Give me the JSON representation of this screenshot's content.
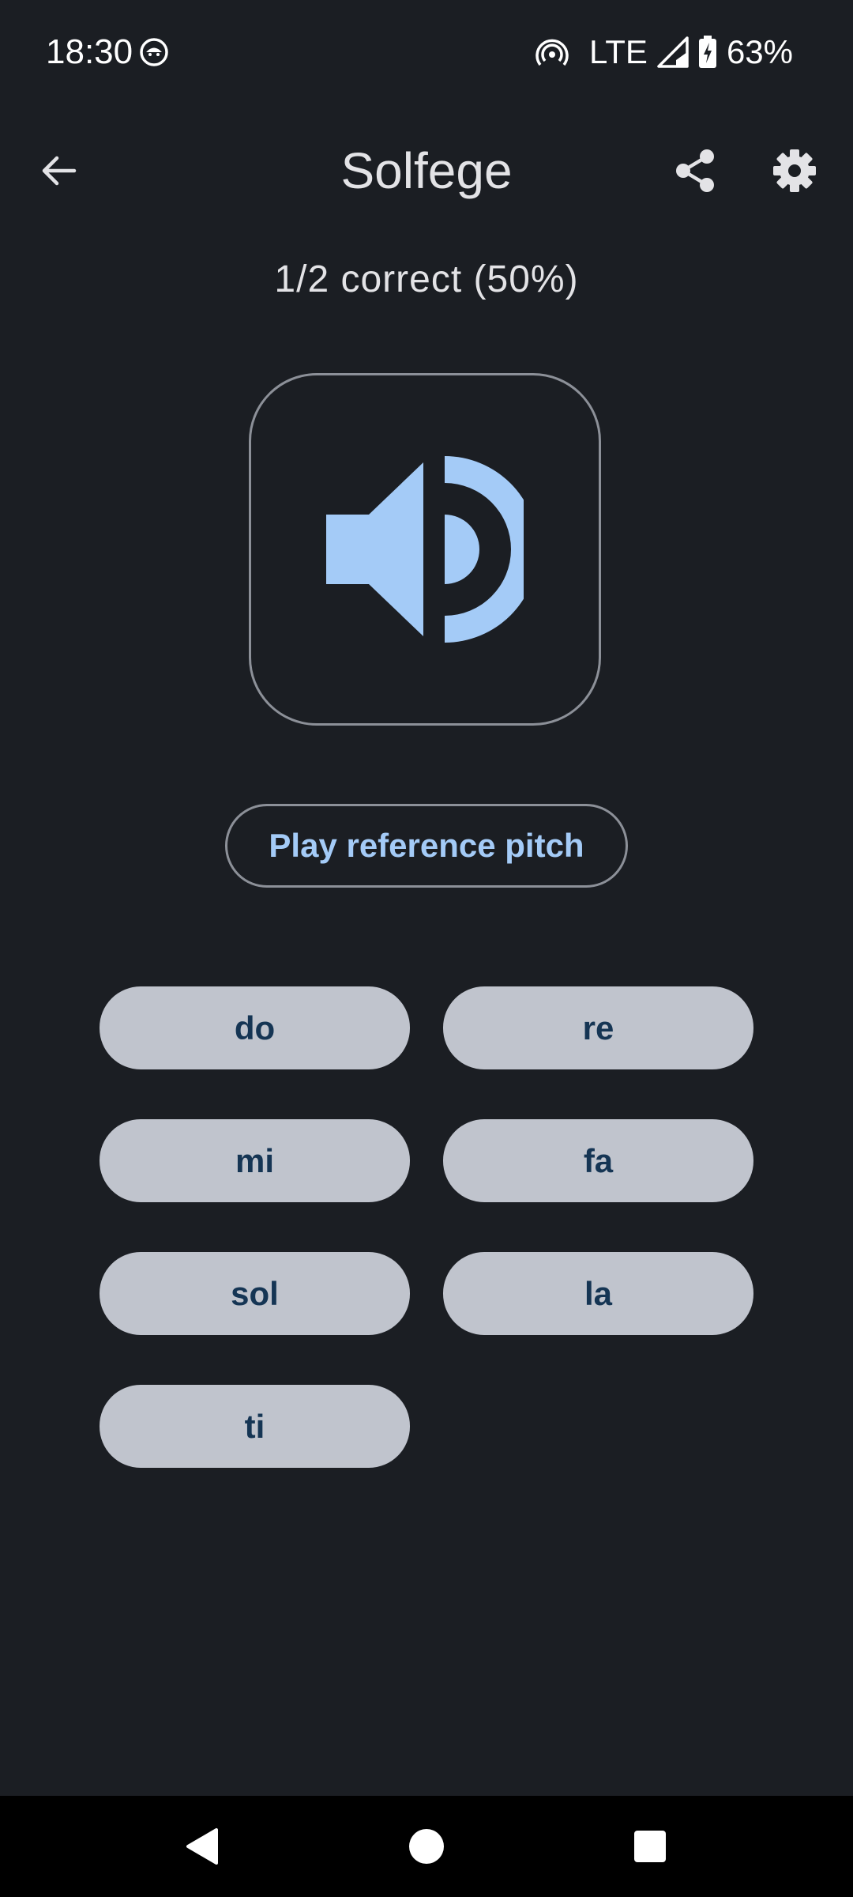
{
  "status_bar": {
    "time": "18:30",
    "network": "LTE",
    "battery": "63%",
    "icons": [
      "notification-face-icon",
      "hotspot-icon",
      "signal-icon",
      "battery-charging-icon"
    ]
  },
  "app_bar": {
    "title": "Solfege",
    "icons": [
      "back-arrow-icon",
      "share-icon",
      "settings-gear-icon"
    ]
  },
  "score": {
    "text": "1/2 correct (50%)"
  },
  "play_card": {
    "icon": "speaker-volume-icon",
    "accent_color": "#a4cbf7"
  },
  "reference_button": {
    "label": "Play reference pitch"
  },
  "notes": [
    "do",
    "re",
    "mi",
    "fa",
    "sol",
    "la",
    "ti"
  ],
  "nav_bar": {
    "icons": [
      "nav-back-icon",
      "nav-home-icon",
      "nav-recents-icon"
    ]
  },
  "colors": {
    "background": "#1b1e23",
    "note_button_bg": "#c0c4cd",
    "note_button_text": "#153554",
    "accent": "#a4cbf7",
    "outline": "#8c9098"
  }
}
